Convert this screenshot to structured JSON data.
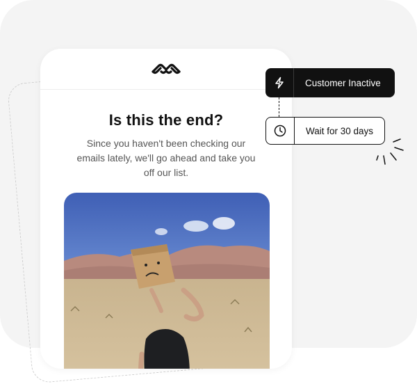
{
  "email": {
    "headline": "Is this the end?",
    "body": "Since you haven't been checking our emails lately, we'll go ahead and take you off our list."
  },
  "workflow": {
    "trigger": {
      "label": "Customer Inactive",
      "icon": "lightning-icon"
    },
    "wait": {
      "label": "Wait for 30 days",
      "icon": "clock-icon"
    }
  },
  "colors": {
    "node_dark": "#111111",
    "background": "#f4f4f4",
    "text_muted": "#555555"
  }
}
